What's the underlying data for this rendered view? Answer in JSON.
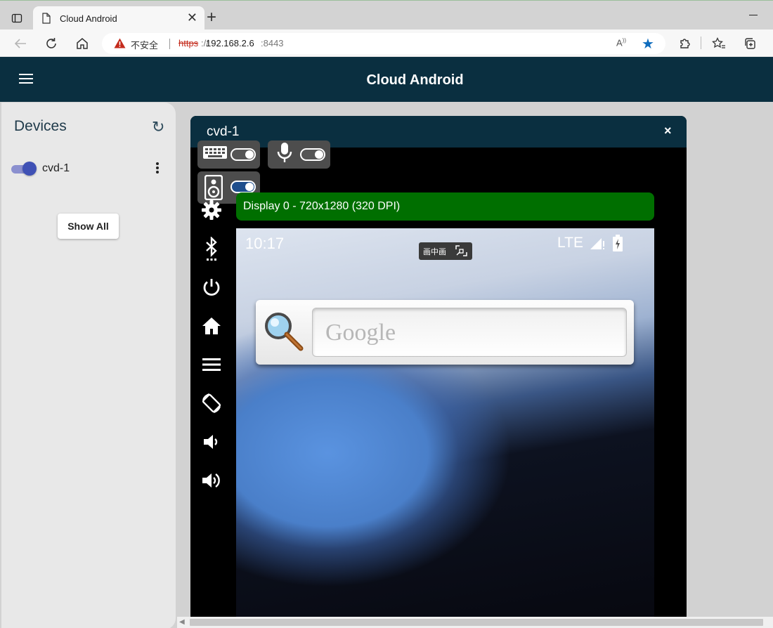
{
  "browser": {
    "tab_title": "Cloud Android",
    "tab_close": "✕",
    "new_tab": "+",
    "security_label": "不安全",
    "url_scheme": "https",
    "url_sep": "://",
    "url_host": "192.168.2.6",
    "url_port": ":8443",
    "read_aloud": "A",
    "favorite_star": "★",
    "accent_color": "#0f6cbd",
    "warning_color": "#c42b1c"
  },
  "app": {
    "title": "Cloud Android",
    "header_color": "#0a2f40"
  },
  "devices_panel": {
    "title": "Devices",
    "refresh_glyph": "↻",
    "devices": [
      {
        "name": "cvd-1",
        "enabled": true
      }
    ],
    "show_all_label": "Show All"
  },
  "device_window": {
    "title": "cvd-1",
    "close_glyph": "×",
    "controls": [
      {
        "icon": "keyboard-icon",
        "toggle": "off"
      },
      {
        "icon": "microphone-icon",
        "toggle": "off"
      },
      {
        "icon": "speaker-icon",
        "toggle": "on"
      }
    ],
    "side_buttons": [
      "settings-icon",
      "bluetooth-icon",
      "power-icon",
      "home-icon",
      "menu-icon",
      "rotate-icon",
      "volume-down-icon",
      "volume-up-icon"
    ],
    "display_label": "Display 0 - 720x1280 (320 DPI)",
    "display_color": "#006f00"
  },
  "phone_screen": {
    "time": "10:17",
    "pip_label": "画中画",
    "network": "LTE",
    "search_brand": "Google"
  }
}
